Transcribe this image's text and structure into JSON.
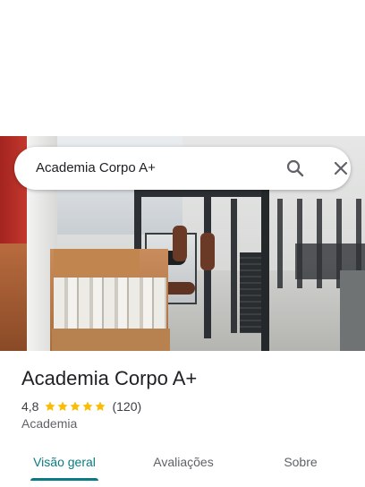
{
  "search": {
    "query": "Academia Corpo A+"
  },
  "place": {
    "name": "Academia Corpo A+",
    "rating": "4,8",
    "stars": 5,
    "review_count": "(120)",
    "category": "Academia"
  },
  "tabs": [
    {
      "label": "Visão geral",
      "active": true
    },
    {
      "label": "Avaliações",
      "active": false
    },
    {
      "label": "Sobre",
      "active": false
    }
  ],
  "colors": {
    "accent": "#0b7b83",
    "star": "#fbbc04",
    "text_primary": "#202124",
    "text_secondary": "#5f6368"
  },
  "icons": [
    "search-icon",
    "close-icon",
    "star-icon"
  ]
}
